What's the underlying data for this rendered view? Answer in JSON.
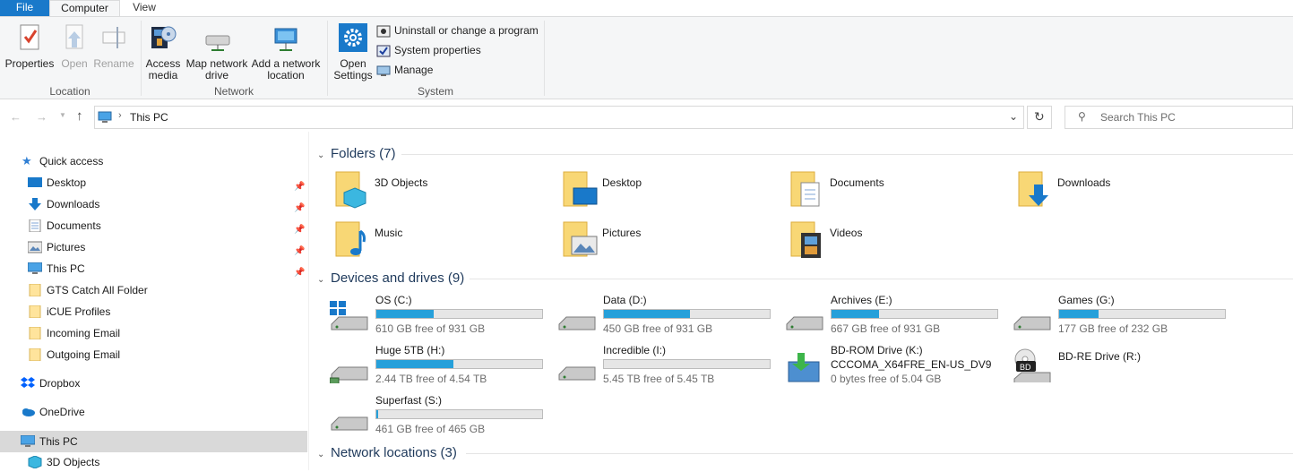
{
  "tabs": {
    "file": "File",
    "computer": "Computer",
    "view": "View"
  },
  "ribbon": {
    "properties": "Properties",
    "open": "Open",
    "rename": "Rename",
    "access_media": "Access media",
    "map_network_drive": "Map network drive",
    "add_network_location": "Add a network location",
    "open_settings": "Open Settings",
    "uninstall": "Uninstall or change a program",
    "system_properties": "System properties",
    "manage": "Manage",
    "group_location": "Location",
    "group_network": "Network",
    "group_system": "System"
  },
  "address": {
    "path": "This PC",
    "search_placeholder": "Search This PC"
  },
  "nav": {
    "quick_access": "Quick access",
    "items": [
      "Desktop",
      "Downloads",
      "Documents",
      "Pictures",
      "This PC",
      "GTS Catch All Folder",
      "iCUE Profiles",
      "Incoming Email",
      "Outgoing Email"
    ],
    "dropbox": "Dropbox",
    "onedrive": "OneDrive",
    "this_pc": "This PC",
    "objects3d": "3D Objects"
  },
  "folders": {
    "header": "Folders (7)",
    "items": [
      "3D Objects",
      "Desktop",
      "Documents",
      "Downloads",
      "Music",
      "Pictures",
      "Videos"
    ]
  },
  "drives": {
    "header": "Devices and drives (9)",
    "items": [
      {
        "name": "OS (C:)",
        "free": "610 GB free of 931 GB",
        "used": 0.345
      },
      {
        "name": "Data (D:)",
        "free": "450 GB free of 931 GB",
        "used": 0.517
      },
      {
        "name": "Archives (E:)",
        "free": "667 GB free of 931 GB",
        "used": 0.284
      },
      {
        "name": "Games (G:)",
        "free": "177 GB free of 232 GB",
        "used": 0.237
      },
      {
        "name": "Huge 5TB (H:)",
        "free": "2.44 TB free of 4.54 TB",
        "used": 0.463
      },
      {
        "name": "Incredible (I:)",
        "free": "5.45 TB free of 5.45 TB",
        "used": 0.0
      },
      {
        "name": "BD-ROM Drive (K:)",
        "name2": "CCCOMA_X64FRE_EN-US_DV9",
        "free": "0 bytes free of 5.04 GB"
      },
      {
        "name": "BD-RE Drive (R:)"
      },
      {
        "name": "Superfast (S:)",
        "free": "461 GB free of 465 GB",
        "used": 0.009
      }
    ]
  },
  "network": {
    "header": "Network locations (3)"
  }
}
